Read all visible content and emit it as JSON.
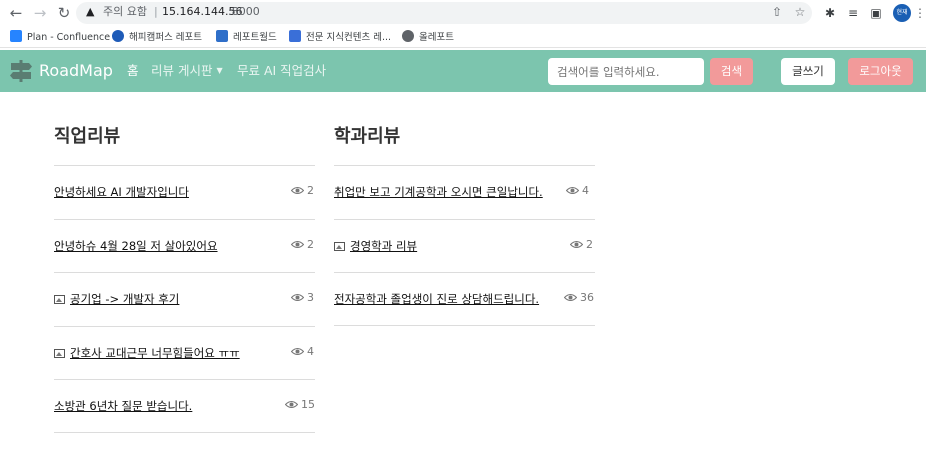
{
  "browser": {
    "security_text": "주의 요함",
    "separator": "|",
    "url_host": "15.164.144.56",
    "url_port": ":8000",
    "profile_label": "현재",
    "bookmarks": [
      {
        "label": "Plan - Confluence",
        "icon": "confluence-icon",
        "color": "#2684ff"
      },
      {
        "label": "해피캠퍼스 레포트",
        "icon": "happycampus-icon",
        "color": "#1e5bb8"
      },
      {
        "label": "레포트월드",
        "icon": "reportworld-icon",
        "color": "#2f6fc9"
      },
      {
        "label": "전문 지식컨텐츠 레...",
        "icon": "expert-content-icon",
        "color": "#3a6fd8"
      },
      {
        "label": "올레포트",
        "icon": "globe-icon",
        "color": "#5f6368"
      }
    ]
  },
  "navbar": {
    "brand": "RoadMap",
    "home": "홈",
    "review_board": "리뷰 게시판",
    "ai_test": "무료 AI 직업검사",
    "search_placeholder": "검색어를 입력하세요.",
    "search_button": "검색",
    "write_button": "글쓰기",
    "logout_button": "로그아웃",
    "color": "#7cc5ae",
    "accent": "#f29a9a"
  },
  "job_reviews": {
    "title": "직업리뷰",
    "posts": [
      {
        "title": "안녕하세요 AI 개발자입니다",
        "has_image": false,
        "views": "2"
      },
      {
        "title": "안녕하슈 4월 28일 저 살아있어요",
        "has_image": false,
        "views": "2"
      },
      {
        "title": "공기업 -> 개발자 후기",
        "has_image": true,
        "views": "3"
      },
      {
        "title": "간호사 교대근무 너무힘들어요 ㅠㅠ",
        "has_image": true,
        "views": "4"
      },
      {
        "title": "소방관 6년차 질문 받습니다.",
        "has_image": false,
        "views": "15"
      }
    ]
  },
  "major_reviews": {
    "title": "학과리뷰",
    "posts": [
      {
        "title": "취업만 보고 기계공학과 오시면 큰일납니다.",
        "has_image": false,
        "views": "4"
      },
      {
        "title": "경영학과 리뷰",
        "has_image": true,
        "views": "2"
      },
      {
        "title": "전자공학과 졸업생이 진로 상담해드립니다.",
        "has_image": false,
        "views": "36"
      }
    ]
  }
}
